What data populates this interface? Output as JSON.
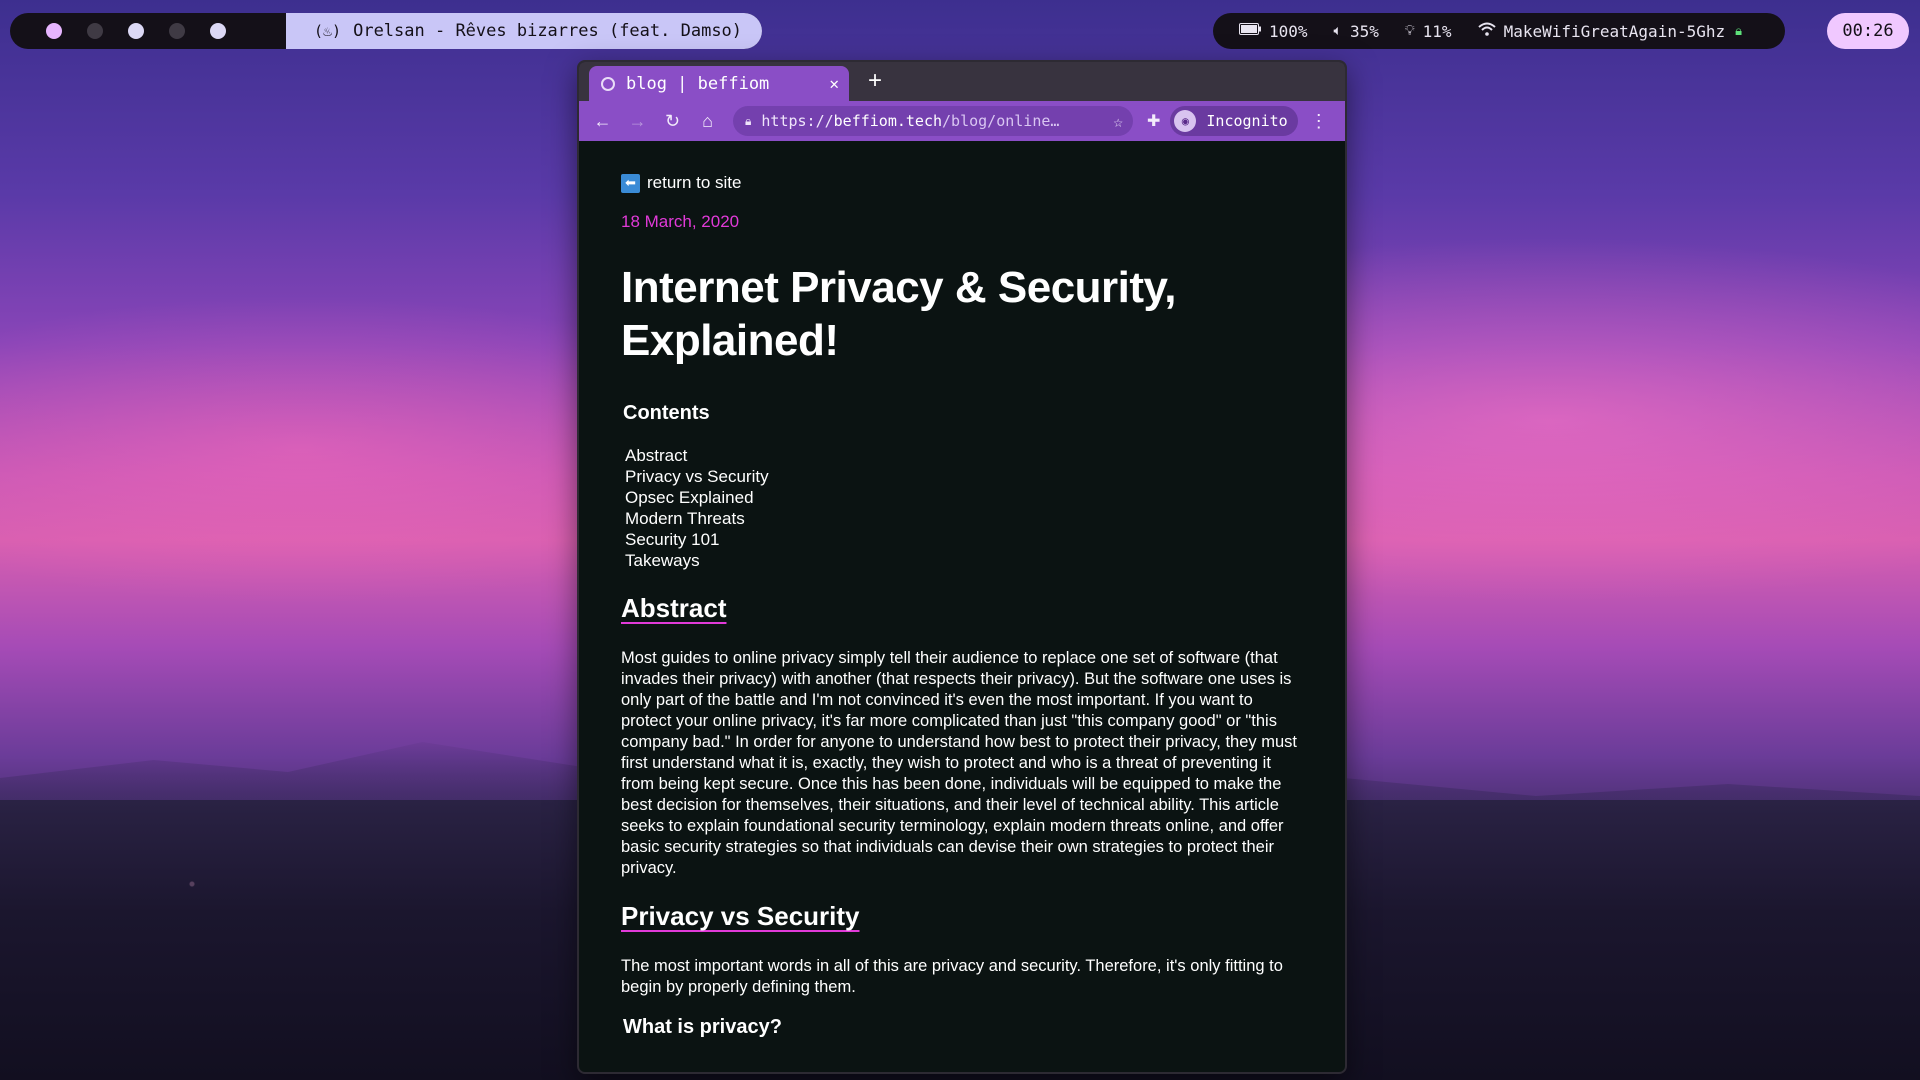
{
  "topbar": {
    "workspaces": [
      {
        "name": "workspace-1",
        "state": "active"
      },
      {
        "name": "workspace-2",
        "state": "empty"
      },
      {
        "name": "workspace-3",
        "state": "used"
      },
      {
        "name": "workspace-4",
        "state": "empty"
      },
      {
        "name": "workspace-5",
        "state": "used"
      }
    ],
    "now_playing": "Orelsan - Rêves bizarres (feat. Damso)",
    "now_playing_icon": "music-flame-icon",
    "battery": "100%",
    "volume": "35%",
    "brightness": "11%",
    "wifi": "MakeWifiGreatAgain-5Ghz",
    "clock": "00:26"
  },
  "browser": {
    "tab_title": "blog | beffiom",
    "url_scheme": "https://",
    "url_host": "beffiom.tech",
    "url_rest": "/blog/online…",
    "profile_label": "Incognito"
  },
  "page": {
    "back_link": "return to site",
    "date": "18 March, 2020",
    "title": "Internet Privacy & Security, Explained!",
    "contents_heading": "Contents",
    "toc": [
      "Abstract",
      "Privacy vs Security",
      "Opsec Explained",
      "Modern Threats",
      "Security 101",
      "Takeways"
    ],
    "abstract_heading": "Abstract",
    "abstract_text": "Most guides to online privacy simply tell their audience to replace one set of software (that invades their privacy) with another (that respects their privacy). But the software one uses is only part of the battle and I'm not convinced it's even the most important. If you want to protect your online privacy, it's far more complicated than just \"this company good\" or \"this company bad.\" In order for anyone to understand how best to protect their privacy, they must first understand what it is, exactly, they wish to protect and who is a threat of preventing it from being kept secure. Once this has been done, individuals will be equipped to make the best decision for themselves, their situations, and their level of technical ability. This article seeks to explain foundational security terminology, explain modern threats online, and offer basic security strategies so that individuals can devise their own strategies to protect their privacy.",
    "privacy_heading": "Privacy vs Security",
    "privacy_text": "The most important words in all of this are privacy and security. Therefore, it's only fitting to begin by properly defining them.",
    "what_is_privacy": "What is privacy?"
  }
}
